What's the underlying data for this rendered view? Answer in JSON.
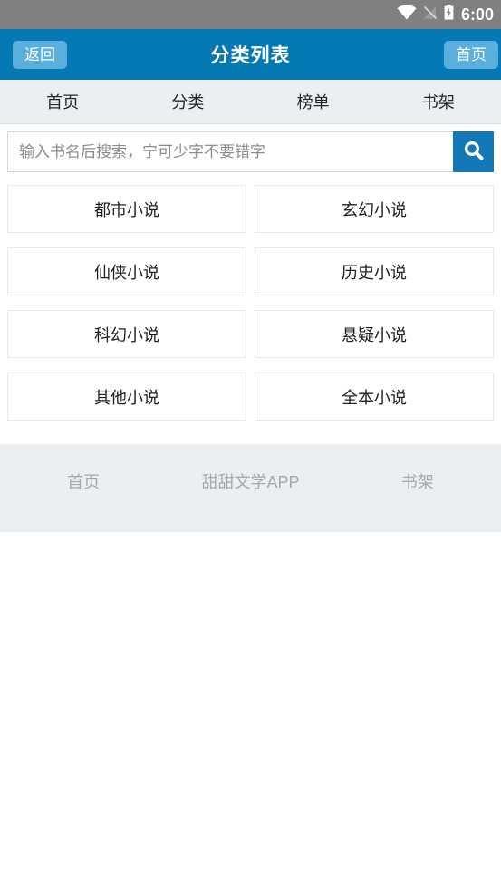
{
  "status_bar": {
    "wifi_icon": "wifi-icon",
    "signal_off_icon": "signal-off-icon",
    "battery_icon": "battery-charging-icon",
    "time": "6:00",
    "background_color": "#808080"
  },
  "header": {
    "title": "分类列表",
    "back_label": "返回",
    "home_label": "首页",
    "background_color": "#0579b4",
    "button_color": "#5aafdd"
  },
  "navbar": {
    "items": [
      {
        "label": "首页"
      },
      {
        "label": "分类"
      },
      {
        "label": "榜单"
      },
      {
        "label": "书架"
      }
    ],
    "background_color": "#eceff1"
  },
  "search": {
    "placeholder": "输入书名后搜索，宁可少字不要错字",
    "value": "",
    "button_icon": "search-icon",
    "button_color": "#1278b8"
  },
  "categories": [
    {
      "label": "都市小说"
    },
    {
      "label": "玄幻小说"
    },
    {
      "label": "仙侠小说"
    },
    {
      "label": "历史小说"
    },
    {
      "label": "科幻小说"
    },
    {
      "label": "悬疑小说"
    },
    {
      "label": "其他小说"
    },
    {
      "label": "全本小说"
    }
  ],
  "footer": {
    "items": [
      {
        "label": "首页"
      },
      {
        "label": "甜甜文学APP"
      },
      {
        "label": "书架"
      }
    ],
    "background_color": "#eceff1",
    "text_color": "#a2a9ad"
  }
}
